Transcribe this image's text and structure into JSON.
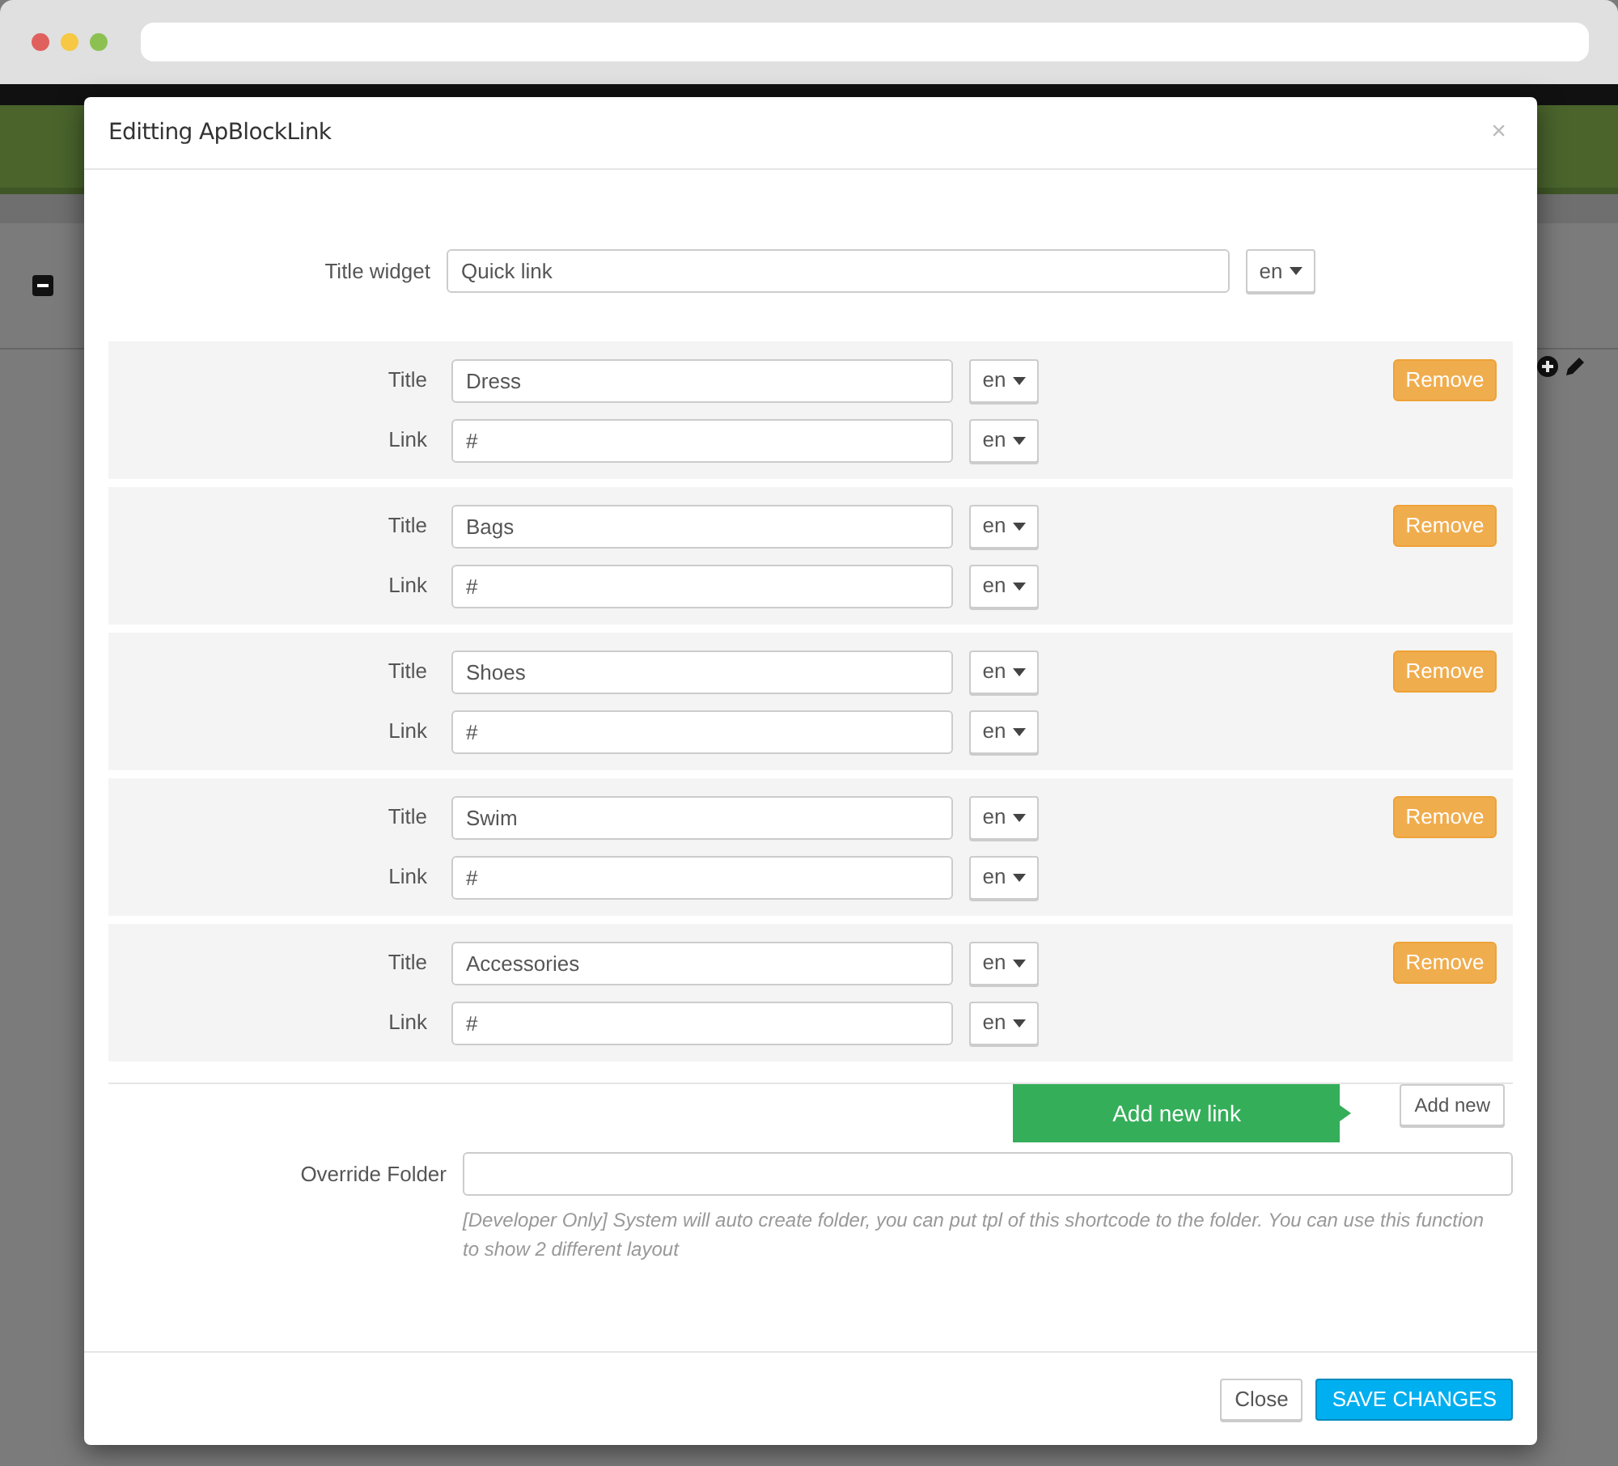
{
  "dialog": {
    "title": "Editting ApBlockLink",
    "close": "×",
    "title_widget": {
      "label": "Title widget",
      "value": "Quick link",
      "lang": "en"
    },
    "links": [
      {
        "title_label": "Title",
        "title": "Dress",
        "title_lang": "en",
        "link_label": "Link",
        "link": "#",
        "link_lang": "en",
        "remove": "Remove"
      },
      {
        "title_label": "Title",
        "title": "Bags",
        "title_lang": "en",
        "link_label": "Link",
        "link": "#",
        "link_lang": "en",
        "remove": "Remove"
      },
      {
        "title_label": "Title",
        "title": "Shoes",
        "title_lang": "en",
        "link_label": "Link",
        "link": "#",
        "link_lang": "en",
        "remove": "Remove"
      },
      {
        "title_label": "Title",
        "title": "Swim",
        "title_lang": "en",
        "link_label": "Link",
        "link": "#",
        "link_lang": "en",
        "remove": "Remove"
      },
      {
        "title_label": "Title",
        "title": "Accessories",
        "title_lang": "en",
        "link_label": "Link",
        "link": "#",
        "link_lang": "en",
        "remove": "Remove"
      }
    ],
    "tooltip": "Add new link",
    "add_new": "Add new",
    "override": {
      "label": "Override Folder",
      "help": "[Developer Only] System will auto create folder, you can put tpl of this shortcode to the folder. You can use this function to show 2 different layout"
    },
    "footer": {
      "close": "Close",
      "save": "SAVE CHANGES"
    }
  }
}
